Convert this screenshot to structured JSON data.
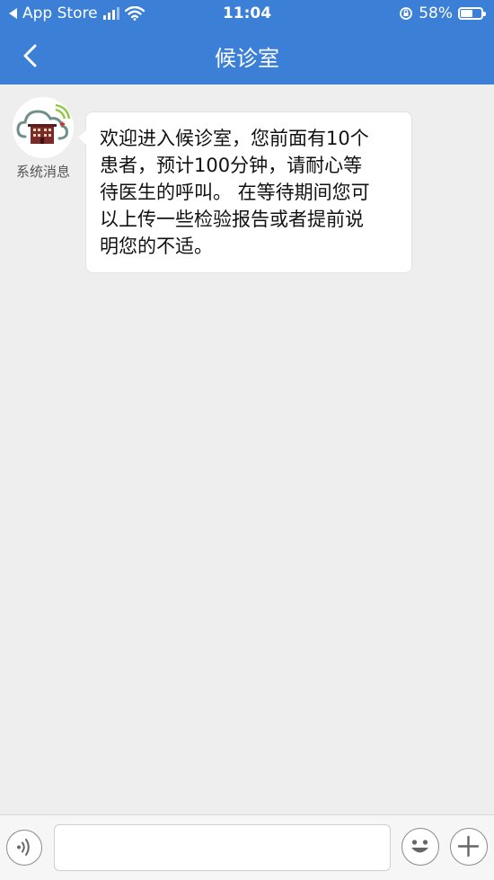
{
  "status_bar": {
    "back_app": "App Store",
    "time": "11:04",
    "battery": "58%"
  },
  "nav": {
    "title": "候诊室"
  },
  "message": {
    "sender": "系统消息",
    "lines": [
      "欢迎进入候诊室，您前面有10个",
      "患者，预计100分钟，请耐心等",
      "待医生的呼叫。 在等待期间您可",
      "以上传一些检验报告或者提前说",
      "明您的不适。"
    ]
  },
  "input_bar": {
    "placeholder": ""
  },
  "colors": {
    "header": "#3b80d6",
    "background": "#efeeef"
  }
}
